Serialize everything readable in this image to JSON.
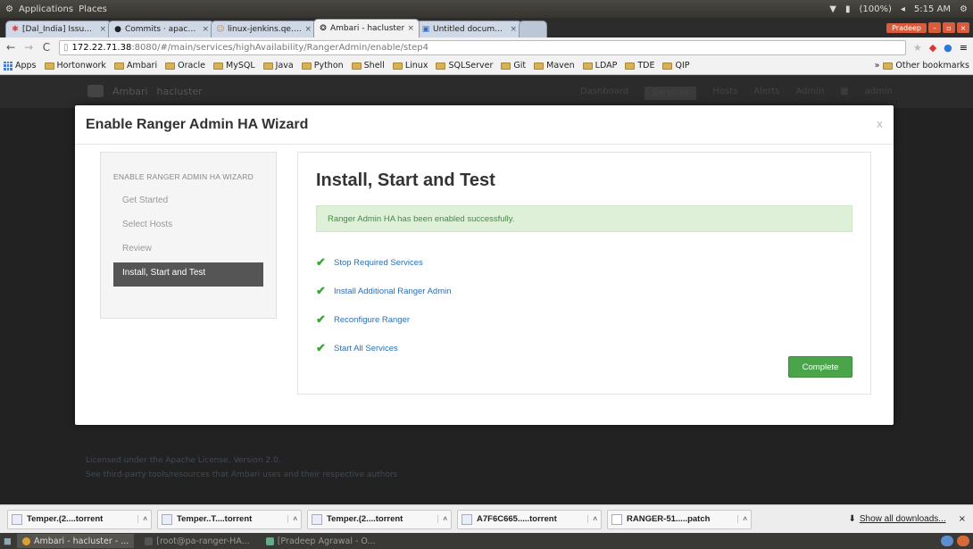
{
  "system_bar": {
    "menu_left": [
      "Applications",
      "Places"
    ],
    "battery": "(100%)",
    "clock": "5:15 AM"
  },
  "tabs": [
    {
      "label": "[Dal_India] Issue Na",
      "icon": "bug-icon"
    },
    {
      "label": "Commits · apache/in",
      "icon": "github-icon"
    },
    {
      "label": "linux-jenkins.qe.hor",
      "icon": "jenkins-icon"
    },
    {
      "label": "Ambari - hacluster",
      "icon": "ambari-icon",
      "active": true
    },
    {
      "label": "Untitled document -",
      "icon": "doc-icon"
    }
  ],
  "profile_name": "Pradeep",
  "address": {
    "host": "172.22.71.38",
    "path": ":8080/#/main/services/highAvailability/RangerAdmin/enable/step4"
  },
  "bookmarks": {
    "apps": "Apps",
    "folders": [
      "Hortonwork",
      "Ambari",
      "Oracle",
      "MySQL",
      "Java",
      "Python",
      "Shell",
      "Linux",
      "SQLServer",
      "Git",
      "Maven",
      "LDAP",
      "TDE",
      "QIP"
    ],
    "other": "Other bookmarks"
  },
  "ambari": {
    "brand": "Ambari",
    "cluster": "hacluster",
    "nav": [
      "Dashboard",
      "Services",
      "Hosts",
      "Alerts",
      "Admin"
    ],
    "user": "admin",
    "footer_line1": "Licensed under the Apache License, Version 2.0.",
    "footer_line2": "See third-party tools/resources that Ambari uses and their respective authors"
  },
  "modal": {
    "title": "Enable Ranger Admin HA Wizard",
    "close": "x",
    "nav_header": "ENABLE RANGER ADMIN HA WIZARD",
    "steps": [
      "Get Started",
      "Select Hosts",
      "Review",
      "Install, Start and Test"
    ],
    "active_step": 3,
    "content_title": "Install, Start and Test",
    "alert": "Ranger Admin HA has been enabled successfully.",
    "tasks": [
      "Stop Required Services",
      "Install Additional Ranger Admin",
      "Reconfigure Ranger",
      "Start All Services"
    ],
    "complete_button": "Complete"
  },
  "downloads": {
    "items": [
      "Temper.(2....torrent",
      "Temper..T....torrent",
      "Temper.(2....torrent",
      "A7F6C665.....torrent",
      "RANGER-51.....patch"
    ],
    "show_all": "Show all downloads...",
    "close": "×"
  },
  "taskbar": {
    "items": [
      "Ambari - hacluster - ...",
      "[root@pa-ranger-HA...",
      "[Pradeep Agrawal - O..."
    ]
  }
}
